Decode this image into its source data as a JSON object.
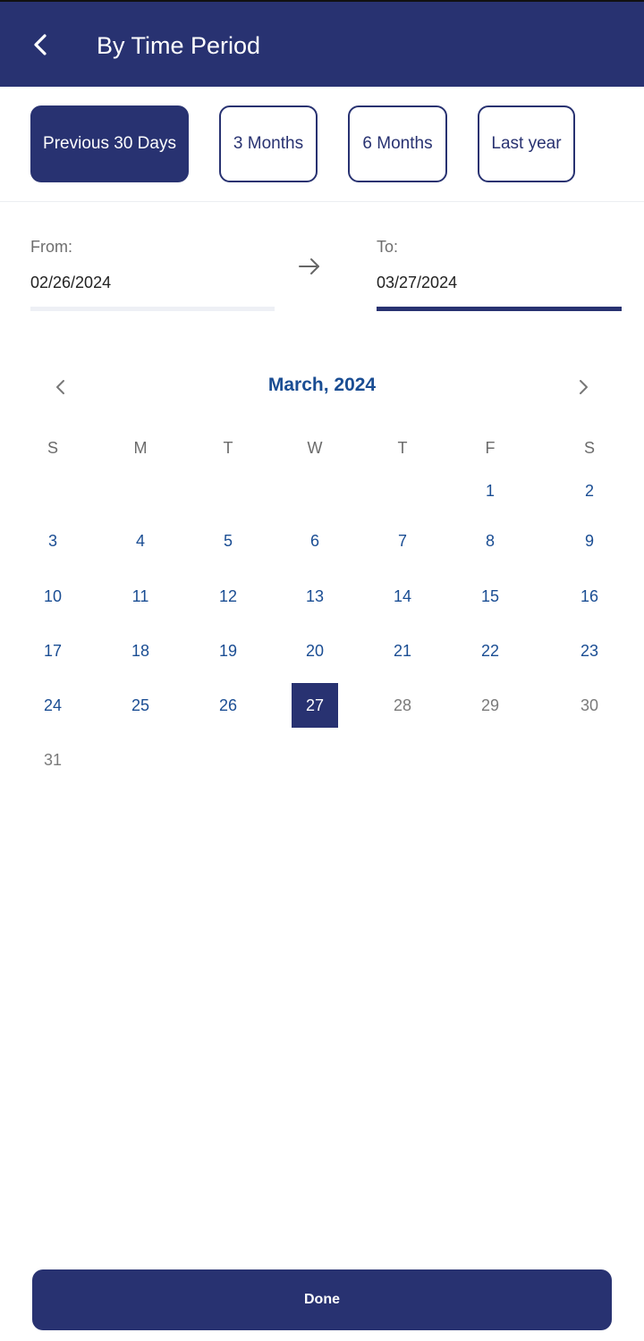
{
  "header": {
    "title": "By Time Period",
    "back_icon": "chevron-left-icon"
  },
  "presets": [
    {
      "label": "Previous 30 Days",
      "active": true
    },
    {
      "label": "3 Months",
      "active": false
    },
    {
      "label": "6 Months",
      "active": false
    },
    {
      "label": "Last year",
      "active": false
    }
  ],
  "range": {
    "from_label": "From:",
    "from_value": "02/26/2024",
    "to_label": "To:",
    "to_value": "03/27/2024",
    "arrow_icon": "arrow-right-icon"
  },
  "calendar": {
    "month_title": "March, 2024",
    "prev_icon": "chevron-left-icon",
    "next_icon": "chevron-right-icon",
    "weekdays": [
      "S",
      "M",
      "T",
      "W",
      "T",
      "F",
      "S"
    ],
    "first_weekday_index": 5,
    "days_in_month": 31,
    "selected_day": 27,
    "last_enabled_day": 27
  },
  "footer": {
    "done_label": "Done"
  },
  "colors": {
    "primary": "#283271",
    "day_text": "#1a4d93",
    "muted_day": "#7a7a7a"
  }
}
